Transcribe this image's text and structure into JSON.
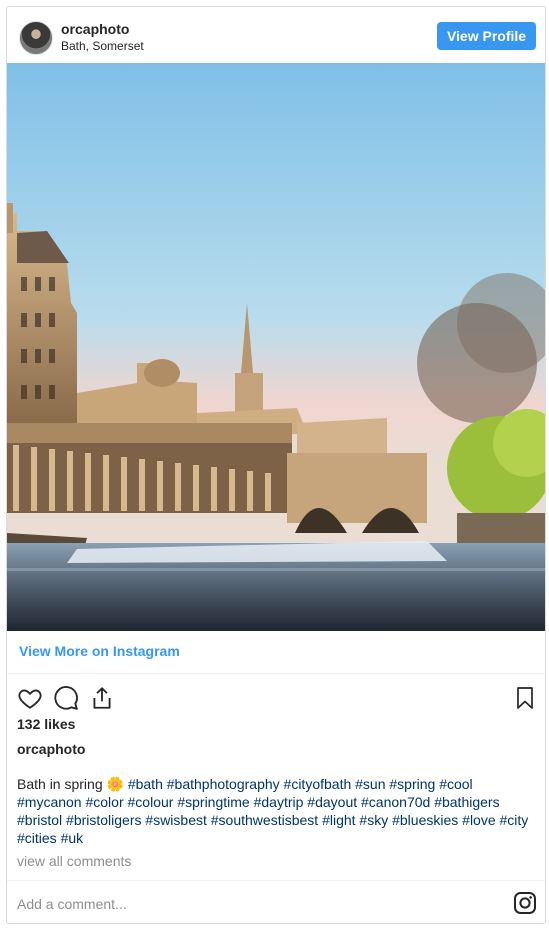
{
  "header": {
    "username": "orcaphoto",
    "location": "Bath, Somerset",
    "view_profile_label": "View Profile"
  },
  "photo": {
    "description_icon": "photo"
  },
  "links": {
    "view_more": "View More on Instagram"
  },
  "actions": {
    "icons": [
      "heart-icon",
      "comment-icon",
      "share-icon",
      "bookmark-icon"
    ]
  },
  "post": {
    "likes": "132 likes",
    "username": "orcaphoto",
    "caption_text": "Bath in spring",
    "caption_emoji": "🌼",
    "hashtags": [
      "#bath",
      "#bathphotography",
      "#cityofbath",
      "#sun",
      "#spring",
      "#cool",
      "#mycanon",
      "#color",
      "#colour",
      "#springtime",
      "#daytrip",
      "#dayout",
      "#canon70d",
      "#bathigers",
      "#bristol",
      "#bristoligers",
      "#swisbest",
      "#southwestisbest",
      "#light",
      "#sky",
      "#blueskies",
      "#love",
      "#city",
      "#cities",
      "#uk"
    ],
    "view_all_comments": "view all comments"
  },
  "comment": {
    "placeholder": "Add a comment..."
  },
  "colors": {
    "accent": "#3897f0",
    "hashtag": "#003569",
    "muted": "#8e8e8e",
    "border": "#dbdbdb"
  }
}
